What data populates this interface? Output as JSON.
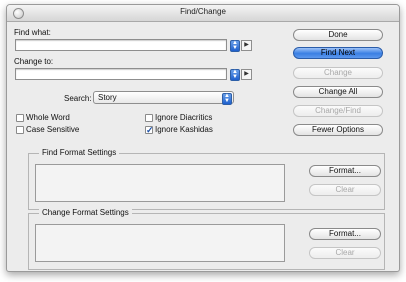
{
  "window": {
    "title": "Find/Change"
  },
  "find": {
    "label": "Find what:",
    "value": ""
  },
  "change": {
    "label": "Change to:",
    "value": ""
  },
  "search": {
    "label": "Search:",
    "value": "Story"
  },
  "options": {
    "whole_word": {
      "label": "Whole Word",
      "checked": false
    },
    "case_sensitive": {
      "label": "Case Sensitive",
      "checked": false
    },
    "ignore_diacritics": {
      "label": "Ignore Diacritics",
      "checked": false
    },
    "ignore_kashidas": {
      "label": "Ignore Kashidas",
      "checked": true
    }
  },
  "buttons": {
    "done": "Done",
    "find_next": "Find Next",
    "change": "Change",
    "change_all": "Change All",
    "change_find": "Change/Find",
    "fewer_options": "Fewer Options"
  },
  "find_format": {
    "title": "Find Format Settings",
    "format": "Format...",
    "clear": "Clear"
  },
  "change_format": {
    "title": "Change Format Settings",
    "format": "Format...",
    "clear": "Clear"
  },
  "colors": {
    "accent": "#3a7fe3",
    "window_bg": "#ececec"
  }
}
